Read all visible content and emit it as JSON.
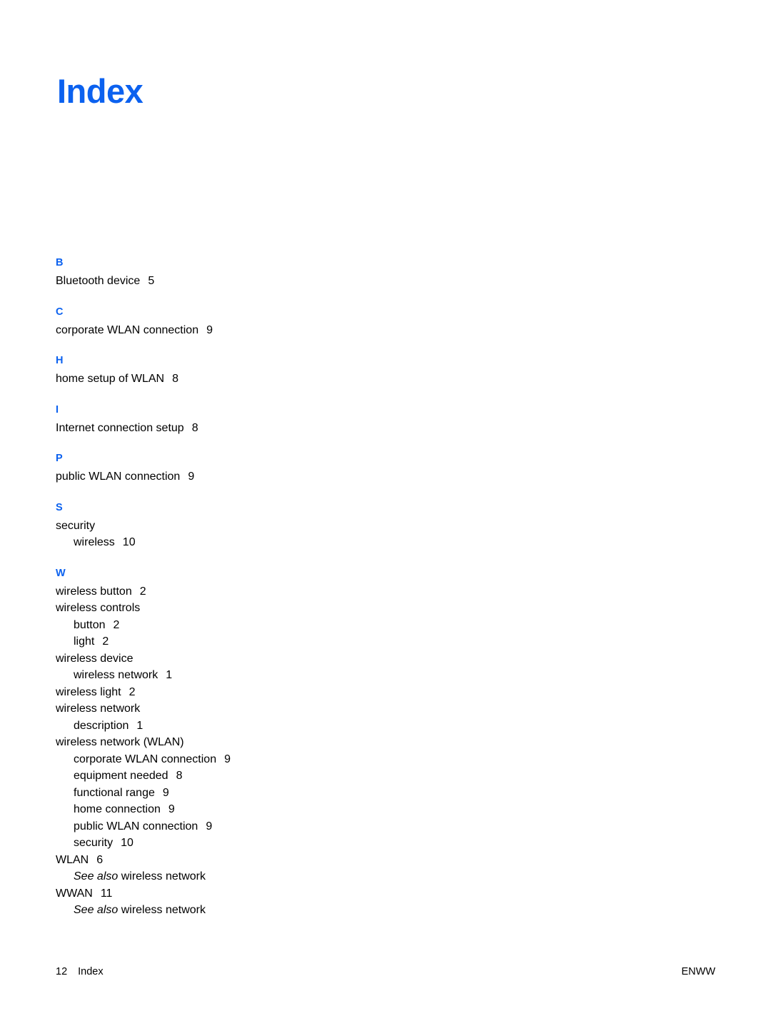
{
  "page": {
    "title": "Index",
    "title_color": "#0b61ef",
    "background_color": "#ffffff",
    "text_color": "#000000"
  },
  "footer": {
    "page_number": "12",
    "section_label": "Index",
    "right_label": "ENWW"
  },
  "sections": [
    {
      "letter": "B",
      "entries": [
        {
          "level": 1,
          "term": "Bluetooth device",
          "page": "5"
        }
      ]
    },
    {
      "letter": "C",
      "entries": [
        {
          "level": 1,
          "term": "corporate WLAN connection",
          "page": "9"
        }
      ]
    },
    {
      "letter": "H",
      "entries": [
        {
          "level": 1,
          "term": "home setup of WLAN",
          "page": "8"
        }
      ]
    },
    {
      "letter": "I",
      "entries": [
        {
          "level": 1,
          "term": "Internet connection setup",
          "page": "8"
        }
      ]
    },
    {
      "letter": "P",
      "entries": [
        {
          "level": 1,
          "term": "public WLAN connection",
          "page": "9"
        }
      ]
    },
    {
      "letter": "S",
      "entries": [
        {
          "level": 1,
          "term": "security",
          "page": ""
        },
        {
          "level": 2,
          "term": "wireless",
          "page": "10"
        }
      ]
    },
    {
      "letter": "W",
      "entries": [
        {
          "level": 1,
          "term": "wireless button",
          "page": "2"
        },
        {
          "level": 1,
          "term": "wireless controls",
          "page": ""
        },
        {
          "level": 2,
          "term": "button",
          "page": "2"
        },
        {
          "level": 2,
          "term": "light",
          "page": "2"
        },
        {
          "level": 1,
          "term": "wireless device",
          "page": ""
        },
        {
          "level": 2,
          "term": "wireless network",
          "page": "1"
        },
        {
          "level": 1,
          "term": "wireless light",
          "page": "2"
        },
        {
          "level": 1,
          "term": "wireless network",
          "page": ""
        },
        {
          "level": 2,
          "term": "description",
          "page": "1"
        },
        {
          "level": 1,
          "term": "wireless network (WLAN)",
          "page": ""
        },
        {
          "level": 2,
          "term": "corporate WLAN connection",
          "page": "9"
        },
        {
          "level": 2,
          "term": "equipment needed",
          "page": "8"
        },
        {
          "level": 2,
          "term": "functional range",
          "page": "9"
        },
        {
          "level": 2,
          "term": "home connection",
          "page": "9"
        },
        {
          "level": 2,
          "term": "public WLAN connection",
          "page": "9"
        },
        {
          "level": 2,
          "term": "security",
          "page": "10"
        },
        {
          "level": 1,
          "term": "WLAN",
          "page": "6"
        },
        {
          "level": 2,
          "term": "See also wireless network",
          "page": "",
          "italic_lead": "See also"
        },
        {
          "level": 1,
          "term": "WWAN",
          "page": "11"
        },
        {
          "level": 2,
          "term": "See also wireless network",
          "page": "",
          "italic_lead": "See also"
        }
      ]
    }
  ]
}
